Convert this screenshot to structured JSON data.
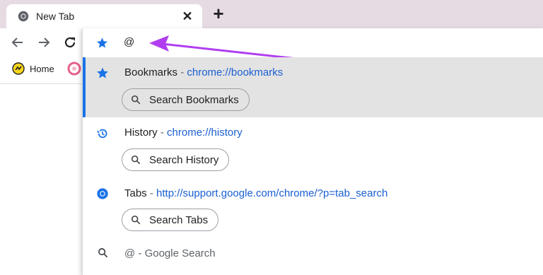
{
  "tab": {
    "title": "New Tab",
    "close_glyph": "✕",
    "favicon": "chrome-icon"
  },
  "new_tab_glyph": "+",
  "toolbar": {
    "back": "back-arrow-icon",
    "forward": "forward-arrow-icon",
    "reload": "reload-icon"
  },
  "bookmarks_bar": {
    "home_label": "Home"
  },
  "omnibox": {
    "input_value": "@",
    "input_icon": "star-icon",
    "suggestions": [
      {
        "title": "Bookmarks",
        "sep": " - ",
        "url": "chrome://bookmarks",
        "icon": "star-icon",
        "chip": "Search Bookmarks",
        "selected": true
      },
      {
        "title": "History",
        "sep": " - ",
        "url": "chrome://history",
        "icon": "history-icon",
        "chip": "Search History",
        "selected": false
      },
      {
        "title": "Tabs",
        "sep": " - ",
        "url": "http://support.google.com/chrome/?p=tab_search",
        "icon": "chrome-icon",
        "chip": "Search Tabs",
        "selected": false
      },
      {
        "title": "@",
        "sep": " - ",
        "url": "Google Search",
        "icon": "search-icon",
        "chip": null,
        "selected": false
      }
    ]
  },
  "colors": {
    "accent": "#1a73e8",
    "annotation_arrow": "#b13ef0",
    "chrome_frame": "#e7dbe3"
  }
}
